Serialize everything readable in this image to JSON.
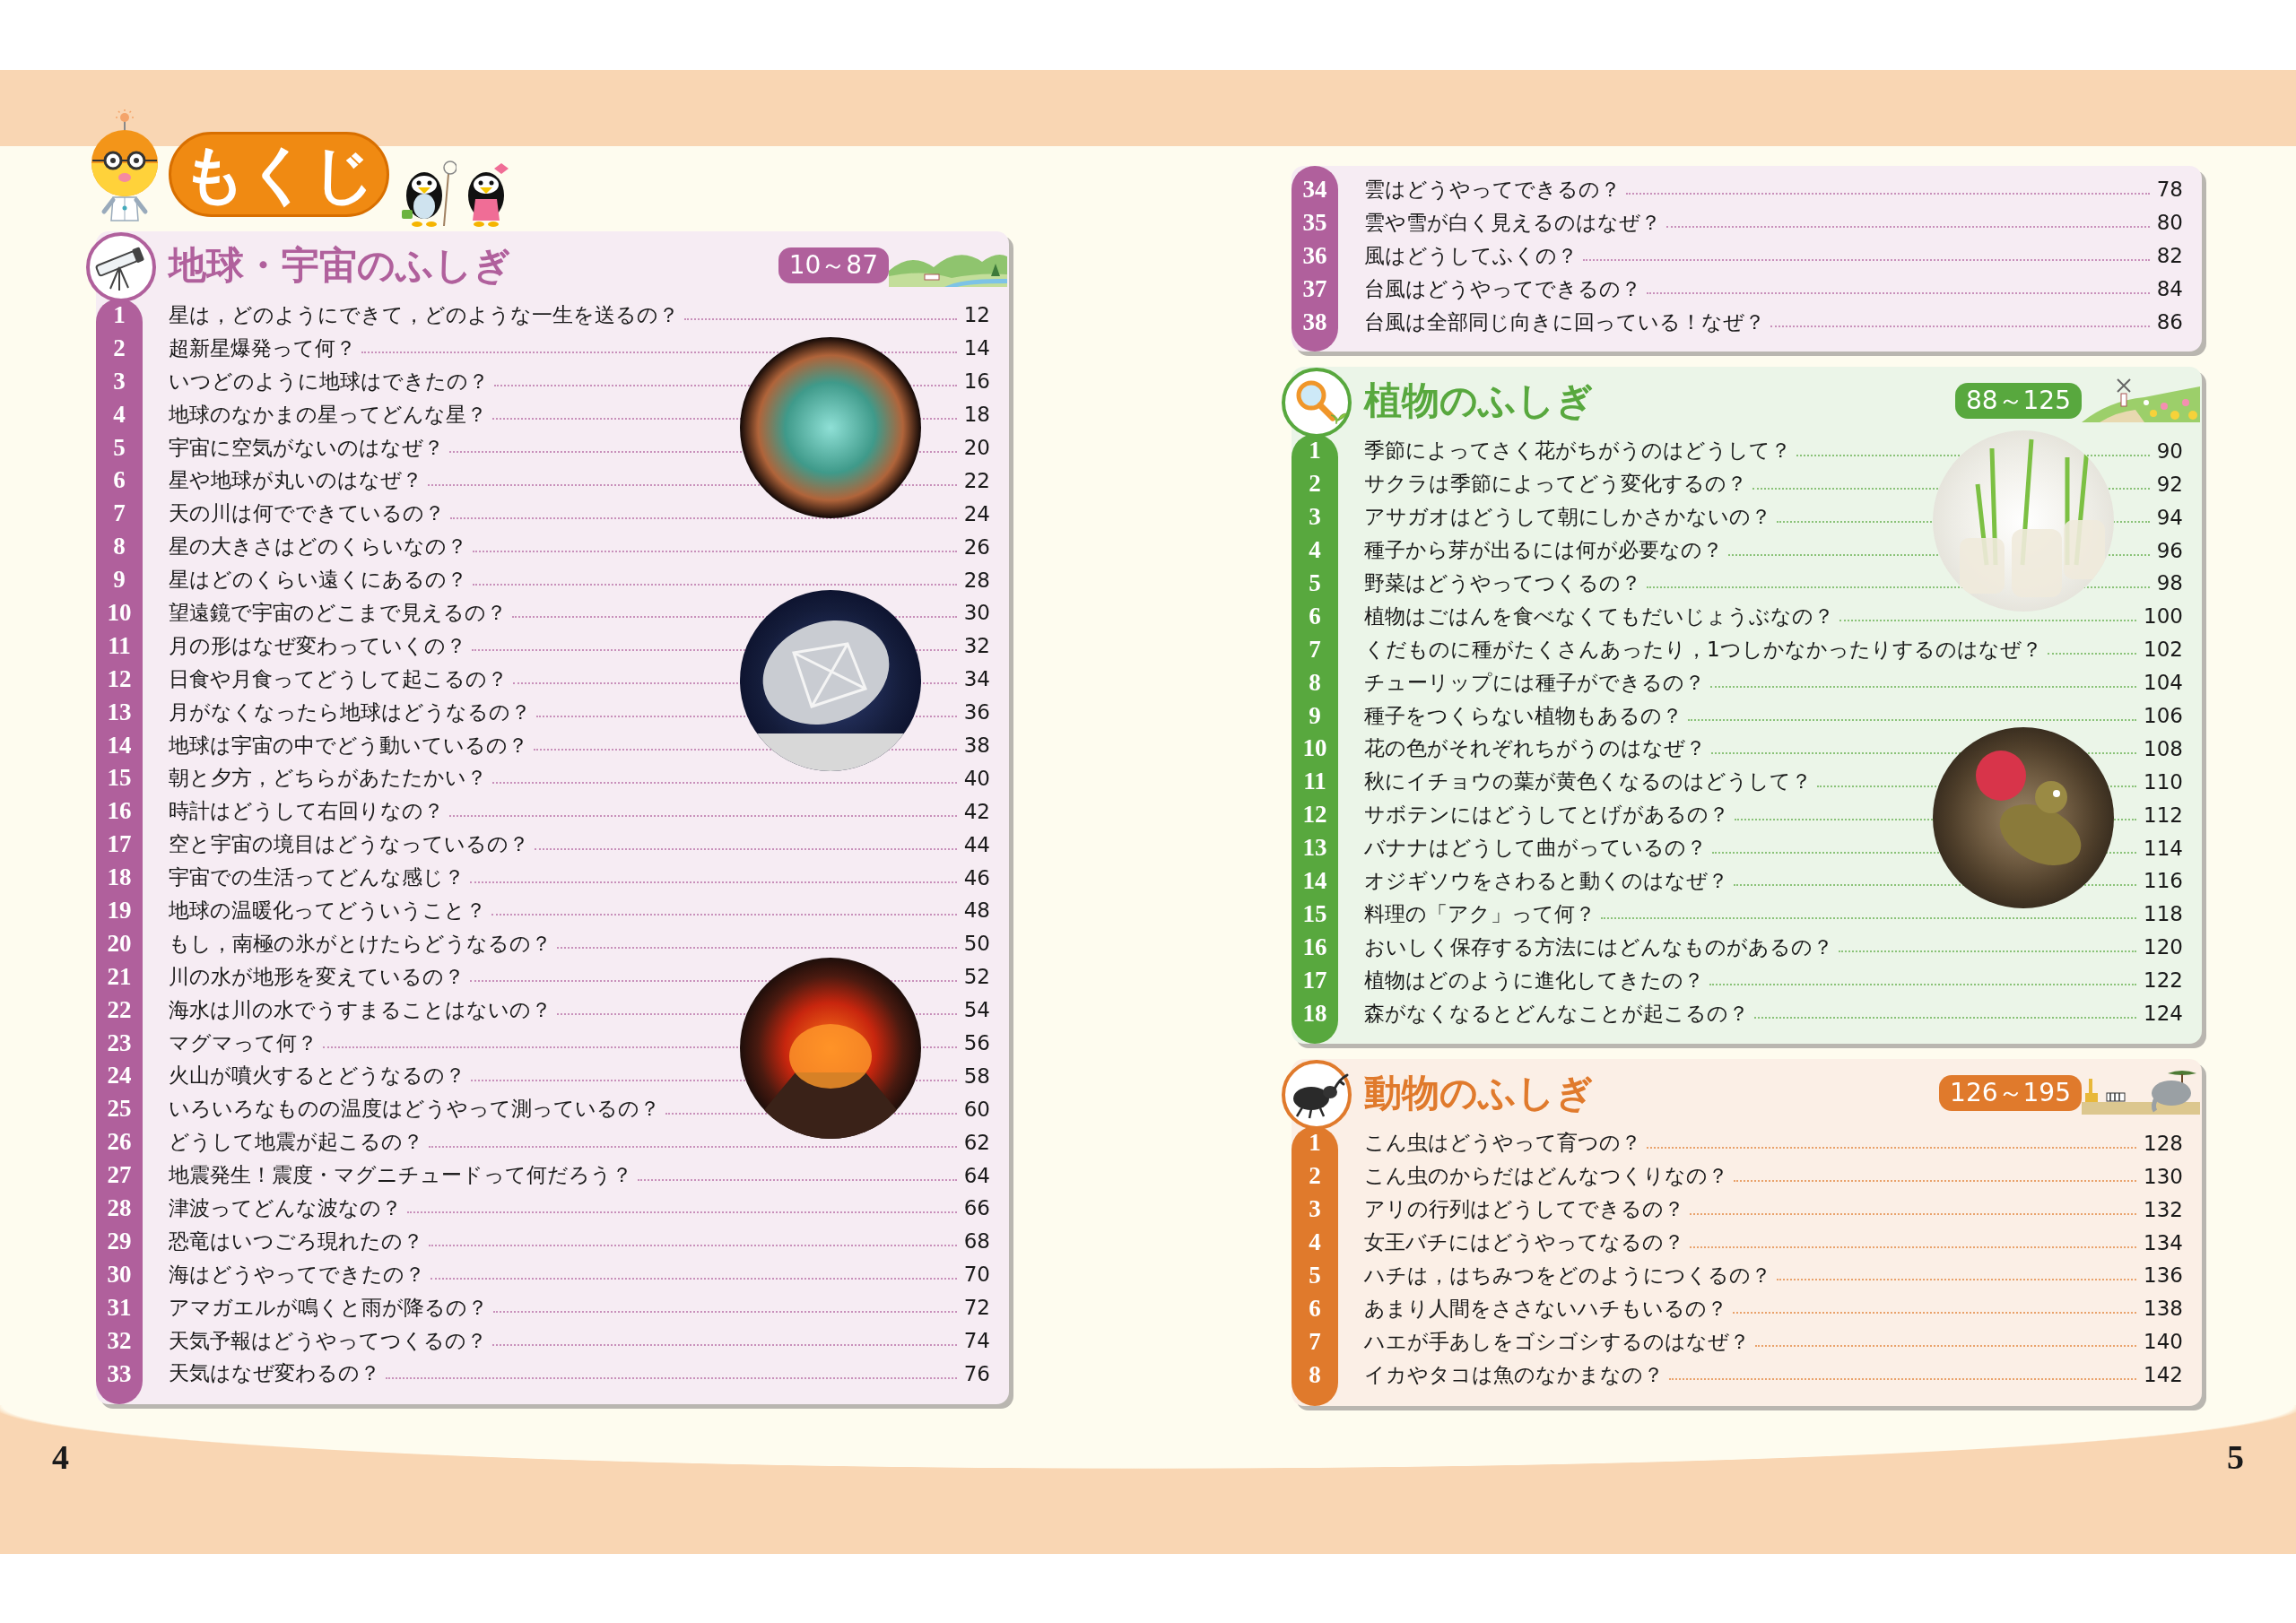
{
  "title": "もくじ",
  "pages": [
    {
      "page_number": "4",
      "cards": [
        {
          "header": {
            "kind": "space",
            "title": "地球・宇宙のふしぎ",
            "range": "10～87"
          },
          "color": "#b0609c",
          "items": [
            {
              "number": "1",
              "question": "星は，どのようにできて，どのような一生を送るの？",
              "page": "12"
            },
            {
              "number": "2",
              "question": "超新星爆発って何？",
              "page": "14"
            },
            {
              "number": "3",
              "question": "いつどのように地球はできたの？",
              "page": "16"
            },
            {
              "number": "4",
              "question": "地球のなかまの星ってどんな星？",
              "page": "18"
            },
            {
              "number": "5",
              "question": "宇宙に空気がないのはなぜ？",
              "page": "20"
            },
            {
              "number": "6",
              "question": "星や地球が丸いのはなぜ？",
              "page": "22"
            },
            {
              "number": "7",
              "question": "天の川は何でできているの？",
              "page": "24"
            },
            {
              "number": "8",
              "question": "星の大きさはどのくらいなの？",
              "page": "26"
            },
            {
              "number": "9",
              "question": "星はどのくらい遠くにあるの？",
              "page": "28"
            },
            {
              "number": "10",
              "question": "望遠鏡で宇宙のどこまで見えるの？",
              "page": "30"
            },
            {
              "number": "11",
              "question": "月の形はなぜ変わっていくの？",
              "page": "32"
            },
            {
              "number": "12",
              "question": "日食や月食ってどうして起こるの？",
              "page": "34"
            },
            {
              "number": "13",
              "question": "月がなくなったら地球はどうなるの？",
              "page": "36"
            },
            {
              "number": "14",
              "question": "地球は宇宙の中でどう動いているの？",
              "page": "38"
            },
            {
              "number": "15",
              "question": "朝と夕方，どちらがあたたかい？",
              "page": "40"
            },
            {
              "number": "16",
              "question": "時計はどうして右回りなの？",
              "page": "42"
            },
            {
              "number": "17",
              "question": "空と宇宙の境目はどうなっているの？",
              "page": "44"
            },
            {
              "number": "18",
              "question": "宇宙での生活ってどんな感じ？",
              "page": "46"
            },
            {
              "number": "19",
              "question": "地球の温暖化ってどういうこと？",
              "page": "48"
            },
            {
              "number": "20",
              "question": "もし，南極の氷がとけたらどうなるの？",
              "page": "50"
            },
            {
              "number": "21",
              "question": "川の水が地形を変えているの？",
              "page": "52"
            },
            {
              "number": "22",
              "question": "海水は川の水でうすまることはないの？",
              "page": "54"
            },
            {
              "number": "23",
              "question": "マグマって何？",
              "page": "56"
            },
            {
              "number": "24",
              "question": "火山が噴火するとどうなるの？",
              "page": "58"
            },
            {
              "number": "25",
              "question": "いろいろなものの温度はどうやって測っているの？",
              "page": "60"
            },
            {
              "number": "26",
              "question": "どうして地震が起こるの？",
              "page": "62"
            },
            {
              "number": "27",
              "question": "地震発生！震度・マグニチュードって何だろう？",
              "page": "64"
            },
            {
              "number": "28",
              "question": "津波ってどんな波なの？",
              "page": "66"
            },
            {
              "number": "29",
              "question": "恐竜はいつごろ現れたの？",
              "page": "68"
            },
            {
              "number": "30",
              "question": "海はどうやってできたの？",
              "page": "70"
            },
            {
              "number": "31",
              "question": "アマガエルが鳴くと雨が降るの？",
              "page": "72"
            },
            {
              "number": "32",
              "question": "天気予報はどうやってつくるの？",
              "page": "74"
            },
            {
              "number": "33",
              "question": "天気はなぜ変わるの？",
              "page": "76"
            }
          ]
        }
      ]
    },
    {
      "page_number": "5",
      "cards": [
        {
          "color": "#b0609c",
          "items": [
            {
              "number": "34",
              "question": "雲はどうやってできるの？",
              "page": "78"
            },
            {
              "number": "35",
              "question": "雲や雪が白く見えるのはなぜ？",
              "page": "80"
            },
            {
              "number": "36",
              "question": "風はどうしてふくの？",
              "page": "82"
            },
            {
              "number": "37",
              "question": "台風はどうやってできるの？",
              "page": "84"
            },
            {
              "number": "38",
              "question": "台風は全部同じ向きに回っている！なぜ？",
              "page": "86"
            }
          ]
        },
        {
          "header": {
            "kind": "plants",
            "title": "植物のふしぎ",
            "range": "88～125"
          },
          "color": "#58a83e",
          "items": [
            {
              "number": "1",
              "question": "季節によってさく花がちがうのはどうして？",
              "page": "90"
            },
            {
              "number": "2",
              "question": "サクラは季節によってどう変化するの？",
              "page": "92"
            },
            {
              "number": "3",
              "question": "アサガオはどうして朝にしかさかないの？",
              "page": "94"
            },
            {
              "number": "4",
              "question": "種子から芽が出るには何が必要なの？",
              "page": "96"
            },
            {
              "number": "5",
              "question": "野菜はどうやってつくるの？",
              "page": "98"
            },
            {
              "number": "6",
              "question": "植物はごはんを食べなくてもだいじょうぶなの？",
              "page": "100"
            },
            {
              "number": "7",
              "question": "くだものに種がたくさんあったり，1つしかなかったりするのはなぜ？",
              "page": "102"
            },
            {
              "number": "8",
              "question": "チューリップには種子ができるの？",
              "page": "104"
            },
            {
              "number": "9",
              "question": "種子をつくらない植物もあるの？",
              "page": "106"
            },
            {
              "number": "10",
              "question": "花の色がそれぞれちがうのはなぜ？",
              "page": "108"
            },
            {
              "number": "11",
              "question": "秋にイチョウの葉が黄色くなるのはどうして？",
              "page": "110"
            },
            {
              "number": "12",
              "question": "サボテンにはどうしてとげがあるの？",
              "page": "112"
            },
            {
              "number": "13",
              "question": "バナナはどうして曲がっているの？",
              "page": "114"
            },
            {
              "number": "14",
              "question": "オジギソウをさわると動くのはなぜ？",
              "page": "116"
            },
            {
              "number": "15",
              "question": "料理の「アク」って何？",
              "page": "118"
            },
            {
              "number": "16",
              "question": "おいしく保存する方法にはどんなものがあるの？",
              "page": "120"
            },
            {
              "number": "17",
              "question": "植物はどのように進化してきたの？",
              "page": "122"
            },
            {
              "number": "18",
              "question": "森がなくなるとどんなことが起こるの？",
              "page": "124"
            }
          ]
        },
        {
          "header": {
            "kind": "animals",
            "title": "動物のふしぎ",
            "range": "126～195"
          },
          "color": "#e07a2c",
          "items": [
            {
              "number": "1",
              "question": "こん虫はどうやって育つの？",
              "page": "128"
            },
            {
              "number": "2",
              "question": "こん虫のからだはどんなつくりなの？",
              "page": "130"
            },
            {
              "number": "3",
              "question": "アリの行列はどうしてできるの？",
              "page": "132"
            },
            {
              "number": "4",
              "question": "女王バチにはどうやってなるの？",
              "page": "134"
            },
            {
              "number": "5",
              "question": "ハチは，はちみつをどのようにつくるの？",
              "page": "136"
            },
            {
              "number": "6",
              "question": "あまり人間をささないハチもいるの？",
              "page": "138"
            },
            {
              "number": "7",
              "question": "ハエが手あしをゴシゴシするのはなぜ？",
              "page": "140"
            },
            {
              "number": "8",
              "question": "イカやタコは魚のなかまなの？",
              "page": "142"
            }
          ]
        }
      ]
    }
  ]
}
